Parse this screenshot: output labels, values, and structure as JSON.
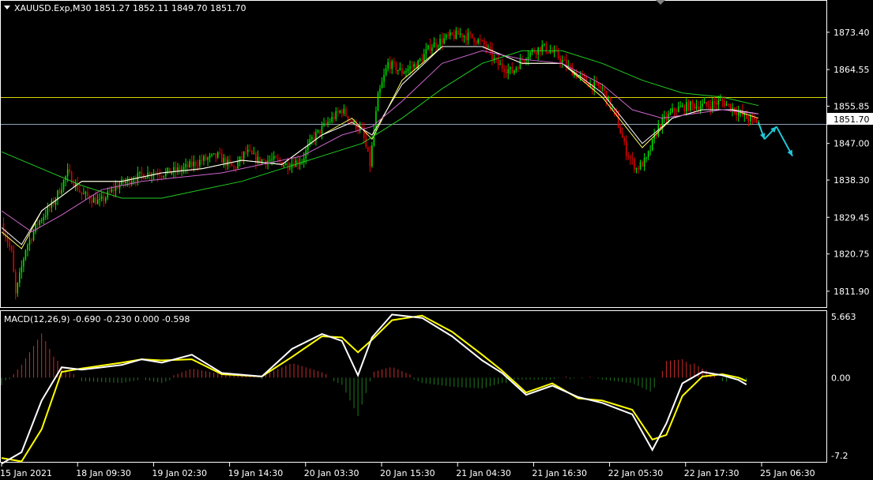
{
  "header": {
    "symbol_line": "XAUUSD.Exp,M30  1851.27 1852.11 1849.70 1851.70",
    "macd_line": "MACD(12,26,9) -0.690 -0.230 0.000 -0.598"
  },
  "colors": {
    "background": "#000000",
    "frame": "#ffffff",
    "candle_up": "#00e600",
    "candle_down": "#e60000",
    "ma_fast": "#ffff66",
    "ma_mid": "#ffffff",
    "ma_slow": "#cc66cc",
    "ma_long": "#22cc22",
    "hline_yellow": "#d8d800",
    "hline_price": "#8fa0b8",
    "arrow": "#22c8d8",
    "macd_line": "#ffffff",
    "signal_line": "#ffff00",
    "hist_pos": "#cc2a2a",
    "hist_neg": "#1f7a1f"
  },
  "chart_data": [
    {
      "type": "candlestick",
      "symbol": "XAUUSD.Exp",
      "timeframe": "M30",
      "ohlc_last": {
        "open": 1851.27,
        "high": 1852.11,
        "low": 1849.7,
        "close": 1851.7
      },
      "ylim": [
        1808.5,
        1880.5
      ],
      "y_ticks": [
        "1873.40",
        "1864.55",
        "1855.85",
        "1847.00",
        "1838.30",
        "1829.45",
        "1820.75",
        "1811.90"
      ],
      "x_ticks": [
        "15 Jan 2021",
        "18 Jan 09:30",
        "19 Jan 02:30",
        "19 Jan 14:30",
        "20 Jan 03:30",
        "20 Jan 15:30",
        "21 Jan 04:30",
        "21 Jan 16:30",
        "22 Jan 05:30",
        "22 Jan 17:30",
        "25 Jan 06:30"
      ],
      "current_price_label": "1851.70",
      "horizontal_lines": [
        1858.0,
        1851.7
      ],
      "close_path": [
        [
          0,
          1828
        ],
        [
          5,
          1821
        ],
        [
          7,
          1811
        ],
        [
          12,
          1822
        ],
        [
          18,
          1828
        ],
        [
          26,
          1833
        ],
        [
          33,
          1840
        ],
        [
          40,
          1835
        ],
        [
          49,
          1833
        ],
        [
          58,
          1837
        ],
        [
          67,
          1839
        ],
        [
          74,
          1840
        ],
        [
          82,
          1840
        ],
        [
          91,
          1841
        ],
        [
          100,
          1843
        ],
        [
          108,
          1844
        ],
        [
          116,
          1841
        ],
        [
          122,
          1845
        ],
        [
          128,
          1843
        ],
        [
          136,
          1843
        ],
        [
          142,
          1842
        ],
        [
          150,
          1843
        ],
        [
          155,
          1848
        ],
        [
          163,
          1852
        ],
        [
          170,
          1855
        ],
        [
          175,
          1852
        ],
        [
          180,
          1850
        ],
        [
          184,
          1842
        ],
        [
          188,
          1858
        ],
        [
          193,
          1866
        ],
        [
          200,
          1864
        ],
        [
          208,
          1866
        ],
        [
          214,
          1870
        ],
        [
          222,
          1872
        ],
        [
          229,
          1873
        ],
        [
          236,
          1872
        ],
        [
          242,
          1870
        ],
        [
          247,
          1866
        ],
        [
          255,
          1864
        ],
        [
          262,
          1868
        ],
        [
          270,
          1870
        ],
        [
          277,
          1868
        ],
        [
          283,
          1865
        ],
        [
          288,
          1863
        ],
        [
          294,
          1861
        ],
        [
          300,
          1860
        ],
        [
          307,
          1853
        ],
        [
          312,
          1845
        ],
        [
          317,
          1841
        ],
        [
          322,
          1843
        ],
        [
          328,
          1851
        ],
        [
          336,
          1855
        ],
        [
          344,
          1856
        ],
        [
          352,
          1856
        ],
        [
          360,
          1857
        ],
        [
          366,
          1855
        ],
        [
          372,
          1853
        ],
        [
          378,
          1852
        ]
      ],
      "moving_averages": [
        {
          "color": "#ffff66",
          "points": [
            [
              0,
              1826
            ],
            [
              10,
              1822
            ],
            [
              20,
              1831
            ],
            [
              40,
              1838
            ],
            [
              60,
              1838
            ],
            [
              80,
              1840
            ],
            [
              100,
              1841
            ],
            [
              120,
              1843
            ],
            [
              140,
              1842
            ],
            [
              160,
              1849
            ],
            [
              175,
              1853
            ],
            [
              185,
              1848
            ],
            [
              200,
              1862
            ],
            [
              220,
              1870
            ],
            [
              240,
              1870
            ],
            [
              260,
              1866
            ],
            [
              280,
              1866
            ],
            [
              300,
              1858
            ],
            [
              320,
              1846
            ],
            [
              335,
              1853
            ],
            [
              350,
              1855
            ],
            [
              365,
              1855
            ],
            [
              378,
              1853
            ]
          ]
        },
        {
          "color": "#ffffff",
          "points": [
            [
              0,
              1827
            ],
            [
              10,
              1823
            ],
            [
              20,
              1831
            ],
            [
              40,
              1838
            ],
            [
              60,
              1838
            ],
            [
              80,
              1840
            ],
            [
              100,
              1841
            ],
            [
              120,
              1843
            ],
            [
              140,
              1842
            ],
            [
              160,
              1849
            ],
            [
              175,
              1852
            ],
            [
              185,
              1849
            ],
            [
              200,
              1861
            ],
            [
              220,
              1870
            ],
            [
              240,
              1870
            ],
            [
              260,
              1866
            ],
            [
              280,
              1866
            ],
            [
              300,
              1859
            ],
            [
              320,
              1847
            ],
            [
              335,
              1853
            ],
            [
              350,
              1855
            ],
            [
              365,
              1855
            ],
            [
              378,
              1854
            ]
          ]
        },
        {
          "color": "#cc66cc",
          "points": [
            [
              0,
              1831
            ],
            [
              15,
              1826
            ],
            [
              30,
              1830
            ],
            [
              50,
              1836
            ],
            [
              70,
              1838
            ],
            [
              90,
              1839
            ],
            [
              110,
              1840
            ],
            [
              130,
              1842
            ],
            [
              150,
              1844
            ],
            [
              170,
              1849
            ],
            [
              185,
              1851
            ],
            [
              200,
              1857
            ],
            [
              220,
              1866
            ],
            [
              240,
              1869
            ],
            [
              260,
              1867
            ],
            [
              280,
              1866
            ],
            [
              300,
              1861
            ],
            [
              315,
              1855
            ],
            [
              330,
              1853
            ],
            [
              345,
              1854
            ],
            [
              360,
              1855
            ],
            [
              378,
              1854
            ]
          ]
        },
        {
          "color": "#22cc22",
          "points": [
            [
              0,
              1845
            ],
            [
              20,
              1841
            ],
            [
              40,
              1837
            ],
            [
              60,
              1834
            ],
            [
              80,
              1834
            ],
            [
              100,
              1836
            ],
            [
              120,
              1838
            ],
            [
              140,
              1841
            ],
            [
              160,
              1844
            ],
            [
              180,
              1847
            ],
            [
              200,
              1853
            ],
            [
              220,
              1860
            ],
            [
              240,
              1866
            ],
            [
              260,
              1869
            ],
            [
              280,
              1869
            ],
            [
              300,
              1866
            ],
            [
              320,
              1862
            ],
            [
              340,
              1859
            ],
            [
              360,
              1858
            ],
            [
              378,
              1856
            ]
          ]
        }
      ],
      "projection_arrows": [
        {
          "from": [
            378,
            1852
          ],
          "to": [
            381,
            1848
          ]
        },
        {
          "from": [
            381,
            1848
          ],
          "to": [
            387,
            1851
          ]
        },
        {
          "from": [
            387,
            1851
          ],
          "to": [
            395,
            1844
          ]
        }
      ]
    },
    {
      "type": "macd",
      "title": "MACD(12,26,9)",
      "values": {
        "macd": -0.69,
        "signal": -0.23,
        "third": 0.0,
        "fourth": -0.598
      },
      "ylim": [
        -7.2,
        5.663
      ],
      "y_ticks": [
        "5.663",
        "0.00",
        "-7.2"
      ],
      "macd_line": [
        [
          0,
          -7.5
        ],
        [
          10,
          -6.5
        ],
        [
          20,
          -2
        ],
        [
          30,
          0.9
        ],
        [
          40,
          0.7
        ],
        [
          60,
          1.1
        ],
        [
          70,
          1.6
        ],
        [
          80,
          1.3
        ],
        [
          95,
          2.0
        ],
        [
          110,
          0.4
        ],
        [
          130,
          0.1
        ],
        [
          145,
          2.5
        ],
        [
          160,
          3.8
        ],
        [
          170,
          3.2
        ],
        [
          178,
          0.2
        ],
        [
          185,
          3.5
        ],
        [
          195,
          5.5
        ],
        [
          210,
          5.2
        ],
        [
          225,
          3.6
        ],
        [
          240,
          1.5
        ],
        [
          250,
          0.4
        ],
        [
          262,
          -1.5
        ],
        [
          275,
          -0.7
        ],
        [
          288,
          -1.7
        ],
        [
          300,
          -2.2
        ],
        [
          315,
          -3.2
        ],
        [
          325,
          -6.3
        ],
        [
          332,
          -4
        ],
        [
          340,
          -0.5
        ],
        [
          350,
          0.5
        ],
        [
          360,
          0.2
        ],
        [
          368,
          -0.2
        ],
        [
          372,
          -0.6
        ]
      ],
      "signal_line": [
        [
          0,
          -7.0
        ],
        [
          10,
          -7.3
        ],
        [
          20,
          -4.5
        ],
        [
          30,
          0.5
        ],
        [
          40,
          0.8
        ],
        [
          60,
          1.3
        ],
        [
          70,
          1.6
        ],
        [
          80,
          1.5
        ],
        [
          95,
          1.6
        ],
        [
          110,
          0.3
        ],
        [
          130,
          0.1
        ],
        [
          145,
          1.8
        ],
        [
          160,
          3.6
        ],
        [
          170,
          3.5
        ],
        [
          178,
          2.2
        ],
        [
          185,
          3.3
        ],
        [
          195,
          5.0
        ],
        [
          210,
          5.4
        ],
        [
          225,
          4.0
        ],
        [
          240,
          2.0
        ],
        [
          250,
          0.6
        ],
        [
          262,
          -1.3
        ],
        [
          275,
          -0.5
        ],
        [
          288,
          -1.8
        ],
        [
          300,
          -2.0
        ],
        [
          315,
          -2.8
        ],
        [
          325,
          -5.4
        ],
        [
          332,
          -5.0
        ],
        [
          340,
          -1.6
        ],
        [
          350,
          0.1
        ],
        [
          360,
          0.3
        ],
        [
          368,
          0.0
        ],
        [
          372,
          -0.3
        ]
      ]
    }
  ]
}
